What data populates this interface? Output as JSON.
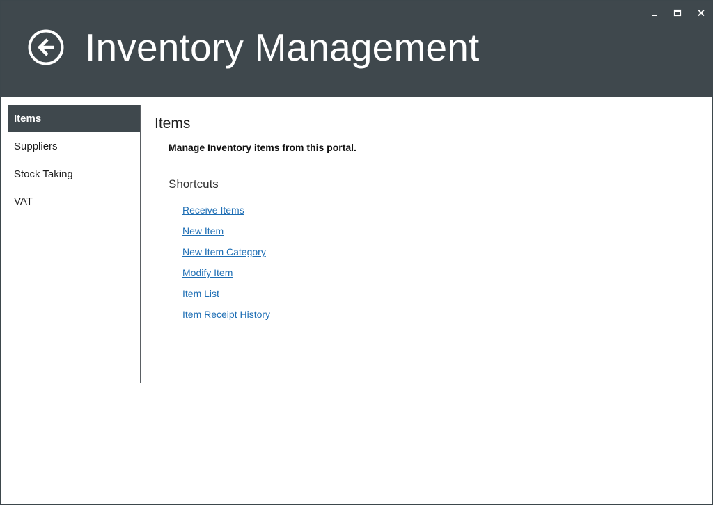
{
  "header": {
    "title": "Inventory Management",
    "back_icon": "back-arrow-circle-icon",
    "window_controls": {
      "minimize_icon": "minimize-icon",
      "maximize_icon": "maximize-icon",
      "close_icon": "close-icon"
    }
  },
  "sidebar": {
    "items": [
      {
        "label": "Items",
        "active": true
      },
      {
        "label": "Suppliers",
        "active": false
      },
      {
        "label": "Stock Taking",
        "active": false
      },
      {
        "label": "VAT",
        "active": false
      }
    ]
  },
  "main": {
    "title": "Items",
    "subtitle": "Manage Inventory items from this portal.",
    "shortcuts_title": "Shortcuts",
    "shortcuts": [
      "Receive Items",
      "New Item",
      "New Item Category",
      "Modify Item",
      "Item List",
      "Item Receipt History"
    ]
  },
  "colors": {
    "header_bg": "#3f484d",
    "active_nav_bg": "#3f484d",
    "link": "#1f6fb5"
  }
}
